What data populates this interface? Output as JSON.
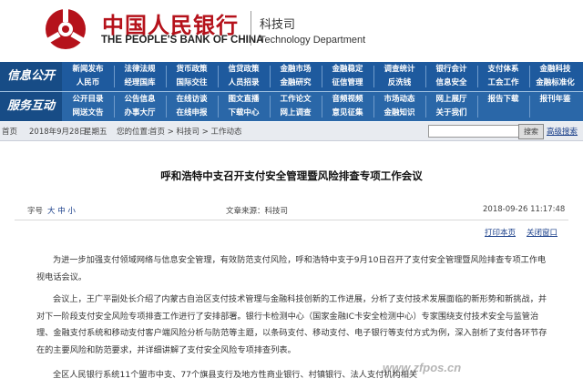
{
  "header": {
    "cn_name": "中国人民银行",
    "en_name": "THE PEOPLE'S BANK OF CHINA",
    "dept_cn": "科技司",
    "dept_en": "Technology Department",
    "brand_color": "#b5121b"
  },
  "nav_info": {
    "title": "信息公开",
    "items": [
      "新闻发布",
      "法律法规",
      "货币政策",
      "信贷政策",
      "金融市场",
      "金融稳定",
      "调查统计",
      "银行会计",
      "支付体系",
      "金融科技",
      "人民币",
      "经理国库",
      "国际交往",
      "人员招录",
      "金融研究",
      "征信管理",
      "反洗钱",
      "信息安全",
      "工会工作",
      "金融标准化"
    ]
  },
  "nav_service": {
    "title": "服务互动",
    "items": [
      "公开目录",
      "公告信息",
      "在线访谈",
      "图文直播",
      "工作论文",
      "音频视频",
      "市场动态",
      "网上展厅",
      "报告下载",
      "报刊年鉴",
      "网送文告",
      "办事大厅",
      "在线申报",
      "下载中心",
      "网上调查",
      "意见征集",
      "金融知识",
      "关于我们",
      "",
      ""
    ]
  },
  "breadcrumb": {
    "home": "首页",
    "date": "2018年9月28日",
    "weekday": "星期五",
    "location_label": "您的位置:",
    "path": "首页 > 科技司 > 工作动态",
    "search_button": "搜索",
    "advanced_search": "高级搜索"
  },
  "article": {
    "title": "呼和浩特中支召开支付安全管理暨风险排查专项工作会议",
    "font_size_label": "字号",
    "font_size_options": "大 中 小",
    "source": "文章来源：科技司",
    "datetime": "2018-09-26 11:17:48",
    "print_label": "打印本页",
    "close_label": "关闭窗口",
    "paragraphs": [
      "为进一步加强支付领域网络与信息安全管理，有效防范支付风险，呼和浩特中支于9月10日召开了支付安全管理暨风险排查专项工作电视电话会议。",
      "会议上，王广平副处长介绍了内蒙古自治区支付技术管理与金融科技创新的工作进展，分析了支付技术发展面临的新形势和新挑战，并对下一阶段支付安全风险专项排查工作进行了安排部署。银行卡检测中心（国家金融IC卡安全检测中心）专家围绕支付技术安全与监管治理、金融支付系统和移动支付客户端风险分析与防范等主题，以条码支付、移动支付、电子银行等支付方式为例，深入剖析了支付各环节存在的主要风险和防范要求，并详细讲解了支付安全风险专项排查列表。",
      "全区人民银行系统11个盟市中支、77个旗县支行及地方性商业银行、村镇银行、法人支付机构相关"
    ]
  },
  "watermark": "www.zfpos.cn"
}
